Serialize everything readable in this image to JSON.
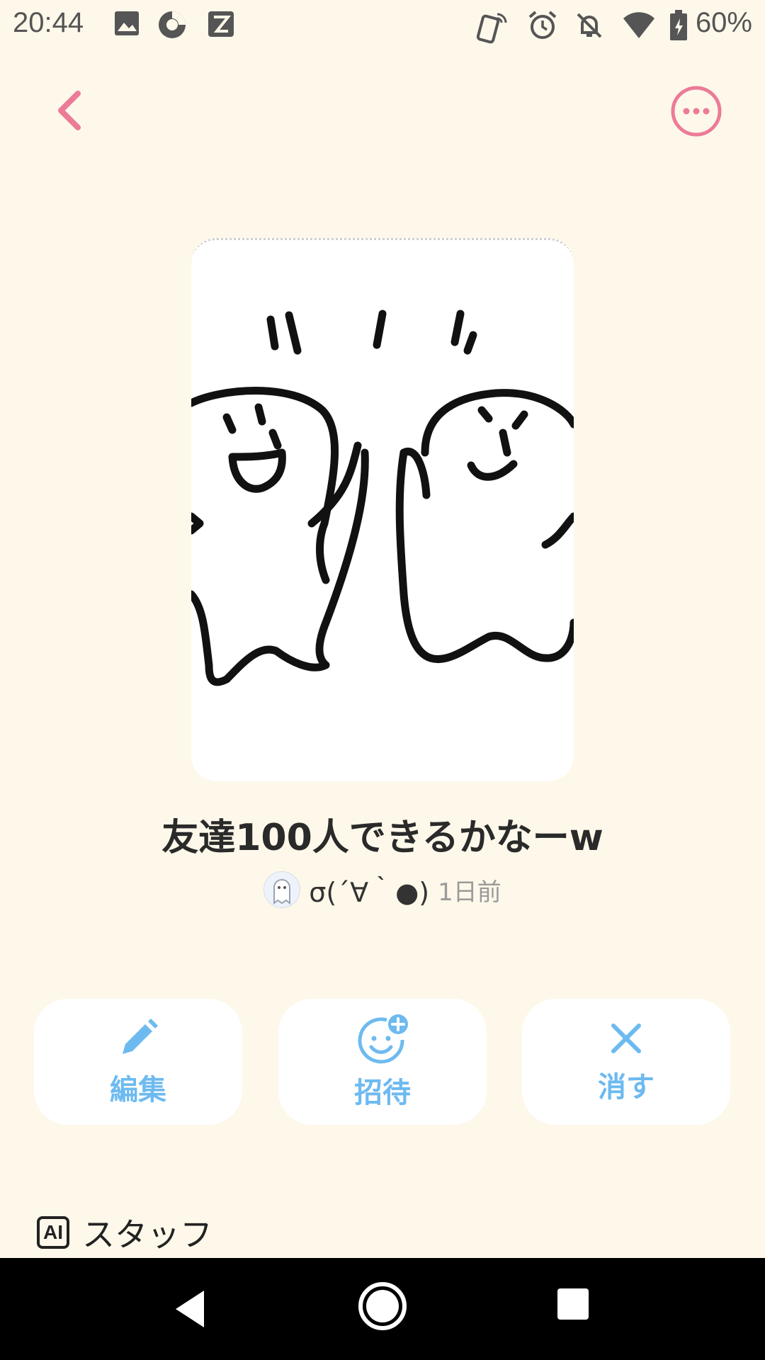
{
  "status_bar": {
    "time": "20:44",
    "battery": "60%",
    "left_icons": [
      "image-icon",
      "sync-icon",
      "app-icon"
    ],
    "right_icons": [
      "nfc-icon",
      "alarm-icon",
      "mute-icon",
      "wifi-icon",
      "battery-icon"
    ]
  },
  "header": {
    "back_icon": "chevron-left-icon",
    "more_icon": "more-horizontal-icon",
    "accent_color": "#ec7b97"
  },
  "post": {
    "title": "友達100人できるかなーw",
    "author": "σ(´∀｀●)",
    "time": "1日前"
  },
  "actions": [
    {
      "label": "編集",
      "icon": "pencil-icon"
    },
    {
      "label": "招待",
      "icon": "invite-face-icon"
    },
    {
      "label": "消す",
      "icon": "close-icon"
    }
  ],
  "action_color": "#6dbaf0",
  "staff": {
    "badge": "AI",
    "label": "スタッフ"
  }
}
